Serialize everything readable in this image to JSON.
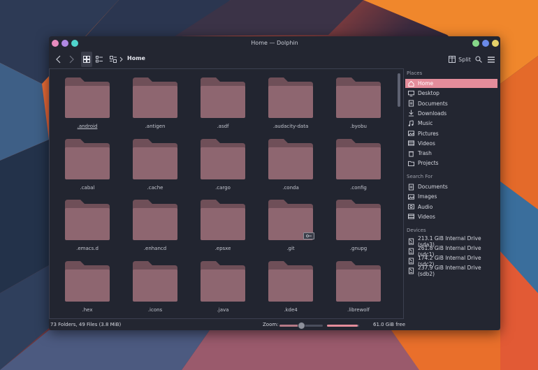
{
  "window": {
    "title": "Home — Dolphin",
    "left_dots": [
      "#e78bbf",
      "#b088e3",
      "#4fd4cc"
    ],
    "right_dots": [
      "#86d789",
      "#6a8ae8",
      "#e5d16a"
    ]
  },
  "toolbar": {
    "back_icon": "chevron-left-icon",
    "forward_icon": "chevron-right-icon",
    "view_modes": [
      "icons-view-icon",
      "compact-view-icon",
      "details-view-icon"
    ],
    "breadcrumb": "Home",
    "split_label": "Split",
    "search_icon": "search-icon",
    "menu_icon": "hamburger-menu-icon"
  },
  "folders": [
    {
      "name": ".android",
      "hovered": true
    },
    {
      "name": ".antigen"
    },
    {
      "name": ".asdf"
    },
    {
      "name": ".audacity-data"
    },
    {
      "name": ".byobu"
    },
    {
      "name": ".cabal"
    },
    {
      "name": ".cache"
    },
    {
      "name": ".cargo"
    },
    {
      "name": ".conda"
    },
    {
      "name": ".config"
    },
    {
      "name": ".emacs.d"
    },
    {
      "name": ".enhancd"
    },
    {
      "name": ".epsxe"
    },
    {
      "name": ".git",
      "badge": true
    },
    {
      "name": ".gnupg"
    },
    {
      "name": ".hex"
    },
    {
      "name": ".icons"
    },
    {
      "name": ".java"
    },
    {
      "name": ".kde4"
    },
    {
      "name": ".librewolf"
    }
  ],
  "colors": {
    "accent": "#e48d9b",
    "folder_body": "#8e6670",
    "folder_tab": "#6f4f58",
    "window_bg": "#232631"
  },
  "places": {
    "places_title": "Places",
    "items": [
      {
        "label": "Home",
        "icon": "home-icon",
        "active": true
      },
      {
        "label": "Desktop",
        "icon": "desktop-icon"
      },
      {
        "label": "Documents",
        "icon": "documents-icon"
      },
      {
        "label": "Downloads",
        "icon": "download-icon"
      },
      {
        "label": "Music",
        "icon": "music-icon"
      },
      {
        "label": "Pictures",
        "icon": "pictures-icon"
      },
      {
        "label": "Videos",
        "icon": "videos-icon"
      },
      {
        "label": "Trash",
        "icon": "trash-icon"
      },
      {
        "label": "Projects",
        "icon": "folder-icon"
      }
    ],
    "search_title": "Search For",
    "search_items": [
      {
        "label": "Documents",
        "icon": "documents-icon"
      },
      {
        "label": "Images",
        "icon": "pictures-icon"
      },
      {
        "label": "Audio",
        "icon": "audio-icon"
      },
      {
        "label": "Videos",
        "icon": "videos-icon"
      }
    ],
    "devices_title": "Devices",
    "devices": [
      {
        "label": "213.1 GiB Internal Drive (sda3)",
        "icon": "drive-icon"
      },
      {
        "label": "261.8 GiB Internal Drive (sdc1)",
        "icon": "drive-icon"
      },
      {
        "label": "174.2 GiB Internal Drive (sdc2)",
        "icon": "drive-icon"
      },
      {
        "label": "237.9 GiB Internal Drive (sdb2)",
        "icon": "drive-icon"
      }
    ]
  },
  "status": {
    "summary": "73 Folders, 49 Files (3.8 MiB)",
    "zoom_label": "Zoom:",
    "zoom_fraction": 0.5,
    "space_used_fraction": 0.95,
    "free_space": "61.0 GiB free"
  }
}
